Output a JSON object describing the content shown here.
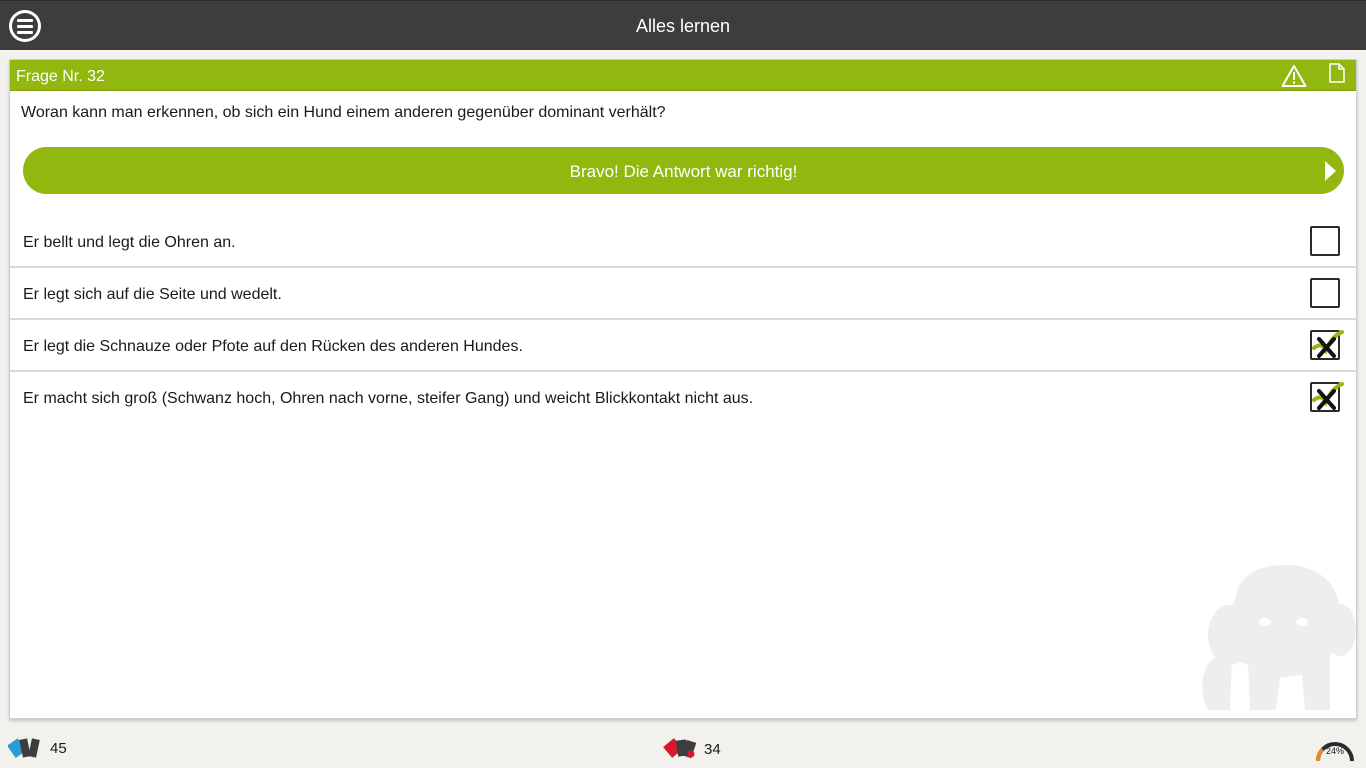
{
  "app": {
    "title": "Alles lernen"
  },
  "question": {
    "number_label": "Frage Nr. 32",
    "text": "Woran kann man erkennen, ob sich ein Hund einem anderen gegenüber dominant verhält?",
    "result_label": "Bravo! Die Antwort war richtig!",
    "answers": [
      {
        "text": "Er bellt und legt die Ohren an.",
        "checked": false
      },
      {
        "text": "Er legt sich auf die Seite und wedelt.",
        "checked": false
      },
      {
        "text": "Er legt die Schnauze oder Pfote auf den Rücken des anderen Hundes.",
        "checked": true
      },
      {
        "text": "Er macht sich groß (Schwanz hoch, Ohren nach vorne, steifer Gang) und weicht Blickkontakt nicht aus.",
        "checked": true
      }
    ]
  },
  "footer": {
    "cards_count": "45",
    "wrong_count": "34",
    "progress_percent": 24,
    "progress_label": "24%"
  },
  "colors": {
    "accent": "#92b80f",
    "topbar": "#3d3d3d",
    "wrong": "#d9182b",
    "cards": "#2a9bd6",
    "progress": "#e58a1f"
  },
  "icons": {
    "menu": "menu-icon",
    "warning": "warning-icon",
    "note": "note-icon",
    "cards": "cards-icon",
    "wrong_cards": "wrong-cards-icon",
    "progress": "progress-gauge-icon"
  }
}
